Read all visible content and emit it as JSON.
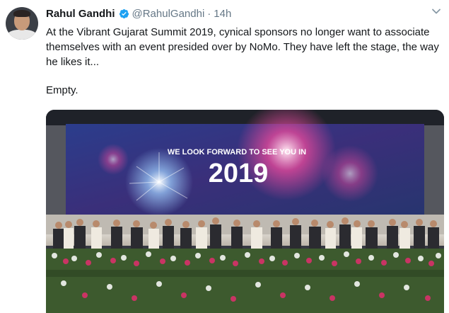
{
  "tweet": {
    "author_name": "Rahul Gandhi",
    "handle": "@RahulGandhi",
    "separator": "·",
    "time": "14h",
    "body_paragraph_1": "At the Vibrant Gujarat Summit 2019, cynical sponsors no longer want to associate themselves with an event presided over by NoMo. They have left the stage, the way he likes it...",
    "body_paragraph_2": "Empty.",
    "verified_color": "#1da1f2"
  },
  "photo": {
    "banner_line": "WE LOOK FORWARD TO SEE YOU IN",
    "banner_year": "2019"
  }
}
